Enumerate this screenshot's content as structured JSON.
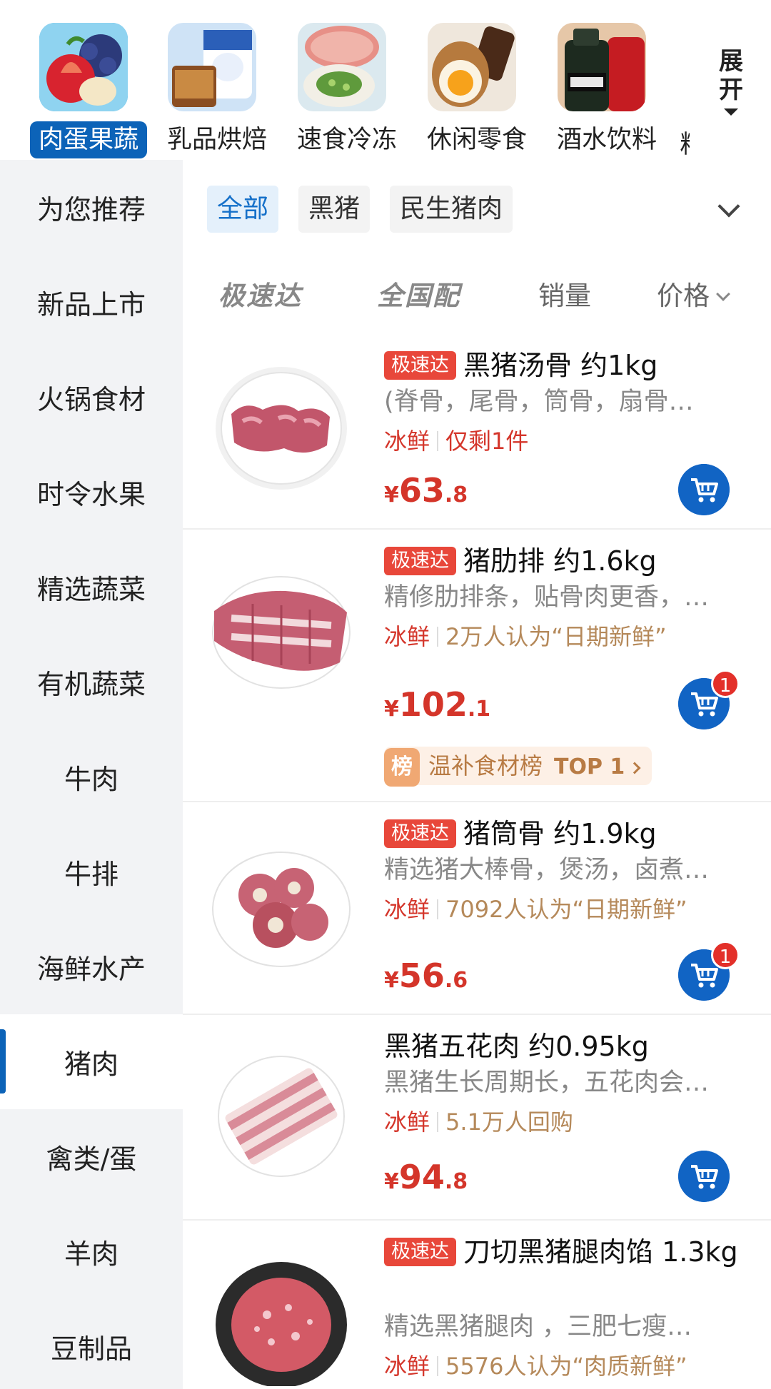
{
  "categories": [
    {
      "label": "肉蛋果蔬",
      "icon": "fruit-basket-icon",
      "active": true
    },
    {
      "label": "乳品烘焙",
      "icon": "yogurt-bread-icon",
      "active": false
    },
    {
      "label": "速食冷冻",
      "icon": "dumpling-icon",
      "active": false
    },
    {
      "label": "休闲零食",
      "icon": "snack-egg-icon",
      "active": false
    },
    {
      "label": "酒水饮料",
      "icon": "wine-bottle-icon",
      "active": false
    }
  ],
  "category_cut_label": "粮",
  "expand_label_1": "展",
  "expand_label_2": "开",
  "sidebar": [
    {
      "label": "为您推荐"
    },
    {
      "label": "新品上市"
    },
    {
      "label": "火锅食材"
    },
    {
      "label": "时令水果"
    },
    {
      "label": "精选蔬菜"
    },
    {
      "label": "有机蔬菜"
    },
    {
      "label": "牛肉"
    },
    {
      "label": "牛排"
    },
    {
      "label": "海鲜水产"
    },
    {
      "label": "猪肉",
      "active": true
    },
    {
      "label": "禽类/蛋"
    },
    {
      "label": "羊肉"
    },
    {
      "label": "豆制品"
    }
  ],
  "chips": [
    {
      "label": "全部",
      "active": true
    },
    {
      "label": "黑猪"
    },
    {
      "label": "民生猪肉"
    }
  ],
  "sort": {
    "fast": "极速达",
    "national": "全国配",
    "sales": "销量",
    "price": "价格"
  },
  "colors": {
    "brand_blue": "#0c63b8",
    "price_red": "#d4352a",
    "tag_red": "#e8473a"
  },
  "products": [
    {
      "tag": "极速达",
      "name": "黑猪汤骨  约1kg",
      "desc": "(脊骨，尾骨，筒骨，扇骨…",
      "fresh": "冰鲜",
      "note": "仅剩1件",
      "note_color": "red",
      "price_int": "63",
      "price_dec": ".8",
      "badge": ""
    },
    {
      "tag": "极速达",
      "name": "猪肋排 约1.6kg",
      "desc": "精修肋排条，贴骨肉更香，…",
      "fresh": "冰鲜",
      "note": "2万人认为“日期新鲜”",
      "note_color": "brown",
      "price_int": "102",
      "price_dec": ".1",
      "badge": "1",
      "rank_badge": "榜",
      "rank_text": "温补食材榜",
      "rank_top": "TOP 1"
    },
    {
      "tag": "极速达",
      "name": "猪筒骨 约1.9kg",
      "desc": "精选猪大棒骨，煲汤，卤煮…",
      "fresh": "冰鲜",
      "note": "7092人认为“日期新鲜”",
      "note_color": "brown",
      "price_int": "56",
      "price_dec": ".6",
      "badge": "1"
    },
    {
      "tag": "",
      "name": "黑猪五花肉 约0.95kg",
      "desc": "黑猪生长周期长，五花肉会…",
      "fresh": "冰鲜",
      "note": "5.1万人回购",
      "note_color": "brown",
      "price_int": "94",
      "price_dec": ".8",
      "badge": ""
    },
    {
      "tag": "极速达",
      "name": "刀切黑猪腿肉馅 1.3kg",
      "desc": "精选黑猪腿肉 ，三肥七瘦…",
      "fresh": "冰鲜",
      "note": "5576人认为“肉质新鲜”",
      "note_color": "brown",
      "price_int": "",
      "price_dec": "",
      "badge": ""
    }
  ],
  "currency": "¥"
}
